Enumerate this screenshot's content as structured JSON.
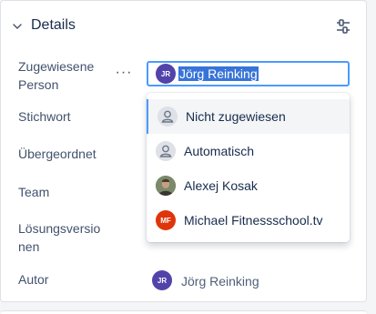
{
  "section": {
    "title": "Details",
    "icons": {
      "collapse": "chevron-down-icon",
      "configure": "sliders-icon"
    }
  },
  "fields": {
    "assignee_label": "Zugewiesene Person",
    "keyword_label": "Stichwort",
    "parent_label": "Übergeordnet",
    "team_label": "Team",
    "fixversion_label": "Lösungsversionen",
    "author_label": "Autor",
    "more_label": "···"
  },
  "assignee_input": {
    "initials": "JR",
    "value": "Jörg Reinking",
    "avatar_color": "#5243aa",
    "focus_color": "#4c9aff"
  },
  "dropdown": {
    "options": [
      {
        "label": "Nicht zugewiesen",
        "avatar": "person-icon"
      },
      {
        "label": "Automatisch",
        "avatar": "person-icon"
      },
      {
        "label": "Alexej Kosak",
        "avatar": "photo"
      },
      {
        "label": "Michael Fitnessschool.tv",
        "initials": "MF",
        "avatar_color": "#de350b"
      }
    ]
  },
  "author": {
    "initials": "JR",
    "name": "Jörg Reinking"
  }
}
